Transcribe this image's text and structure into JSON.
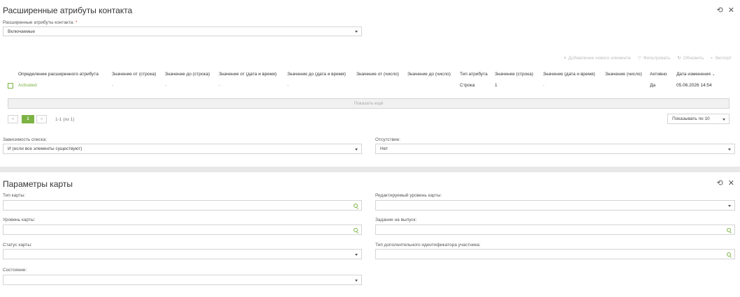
{
  "contact_panel": {
    "title": "Расширенные атрибуты контакта",
    "tools": "⟲ ✕",
    "attr_label": "Расширенные атрибуты контакта:",
    "required_mark": "*",
    "attr_value": "Включаемые",
    "toolbar": {
      "add": "Добавление нового элемента",
      "filter": "Фильтровать",
      "refresh": "Обновить",
      "export": "Экспорт",
      "icons": {
        "add": "+",
        "filter": "▽",
        "refresh": "↻",
        "export": "▪"
      }
    },
    "table": {
      "headers": [
        "Определение расширенного атрибута",
        "Значение от (строка)",
        "Значение до (строка)",
        "Значение от (дата и время)",
        "Значение до (дата и время)",
        "Значение от (число)",
        "Значение до (число)",
        "Тип атрибута",
        "Значение (строка)",
        "Значение (дата и время)",
        "Значение (число)",
        "Активно",
        "Дата изменения"
      ],
      "sort_indicator": "⌄",
      "rows": [
        [
          "Activated",
          "-",
          "-",
          "-",
          "-",
          "",
          "",
          "Строка",
          "1",
          "-",
          "",
          "Да",
          "05.06.2026 14:54"
        ]
      ]
    },
    "show_more": "Показать ещё",
    "pager": {
      "prev": "«",
      "page": "1",
      "next": "»",
      "summary": "1-1 (из 1)"
    },
    "per_page": "Показывать по 10",
    "dependency_label": "Зависимость списка:",
    "dependency_value": "И (если все элементы существуют)",
    "absence_label": "Отсутствие:",
    "absence_value": "Нет"
  },
  "card_panel": {
    "title": "Параметры карты",
    "tools": "⟲ ✕",
    "fields": {
      "card_type": "Тип карты:",
      "editable_level": "Редактируемый уровень карты:",
      "card_level": "Уровень карты:",
      "issue_task": "Задание на выпуск:",
      "card_status": "Статус карты:",
      "extra_id_type": "Тип дополнительного идентификатора участника:",
      "state": "Состояние:"
    }
  }
}
